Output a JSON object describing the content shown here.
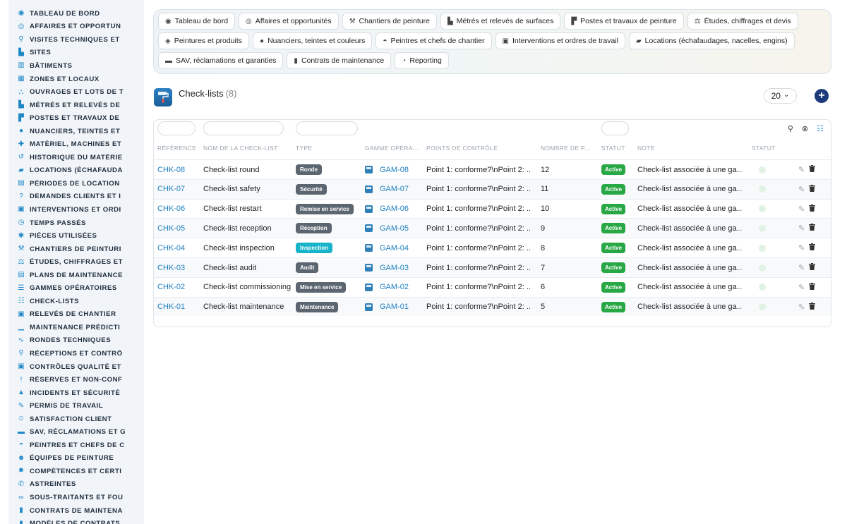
{
  "sidebar": {
    "items": [
      {
        "icon": "dashboard-icon",
        "glyph": "◉",
        "label": "TABLEAU DE BORD"
      },
      {
        "icon": "target-icon",
        "glyph": "◎",
        "label": "AFFAIRES ET OPPORTUN"
      },
      {
        "icon": "pin-icon",
        "glyph": "⚲",
        "label": "VISITES TECHNIQUES ET"
      },
      {
        "icon": "ruler-icon",
        "glyph": "▙",
        "label": "SITES"
      },
      {
        "icon": "building-icon",
        "glyph": "▥",
        "label": "BÂTIMENTS"
      },
      {
        "icon": "zones-icon",
        "glyph": "▦",
        "label": "ZONES ET LOCAUX"
      },
      {
        "icon": "hierarchy-icon",
        "glyph": "⛬",
        "label": "OUVRAGES ET LOTS DE T"
      },
      {
        "icon": "ruler-icon",
        "glyph": "▙",
        "label": "MÉTRÉS ET RELEVÉS DE"
      },
      {
        "icon": "paint-roller-icon",
        "glyph": "▛",
        "label": "POSTES ET TRAVAUX DE"
      },
      {
        "icon": "palette-icon",
        "glyph": "●",
        "label": "NUANCIERS, TEINTES ET"
      },
      {
        "icon": "tools-icon",
        "glyph": "✚",
        "label": "MATÉRIEL, MACHINES ET"
      },
      {
        "icon": "history-icon",
        "glyph": "↺",
        "label": "HISTORIQUE DU MATÉRIE"
      },
      {
        "icon": "truck-icon",
        "glyph": "▰",
        "label": "LOCATIONS (ÉCHAFAUDA"
      },
      {
        "icon": "calendar-icon",
        "glyph": "▤",
        "label": "PÉRIODES DE LOCATION"
      },
      {
        "icon": "question-icon",
        "glyph": "?",
        "label": "DEMANDES CLIENTS ET I"
      },
      {
        "icon": "clipboard-icon",
        "glyph": "▣",
        "label": "INTERVENTIONS ET ORDI"
      },
      {
        "icon": "clock-icon",
        "glyph": "◷",
        "label": "TEMPS PASSÉS"
      },
      {
        "icon": "puzzle-icon",
        "glyph": "✱",
        "label": "PIÈCES UTILISÉES"
      },
      {
        "icon": "hammer-icon",
        "glyph": "⚒",
        "label": "CHANTIERS DE PEINTURI"
      },
      {
        "icon": "drafting-icon",
        "glyph": "⚖",
        "label": "ÉTUDES, CHIFFRAGES ET"
      },
      {
        "icon": "calendar-icon",
        "glyph": "▤",
        "label": "PLANS DE MAINTENANCE"
      },
      {
        "icon": "list-icon",
        "glyph": "☰",
        "label": "GAMMES OPÉRATOIRES"
      },
      {
        "icon": "checklist-icon",
        "glyph": "☷",
        "label": "CHECK-LISTS"
      },
      {
        "icon": "clipboard-icon",
        "glyph": "▣",
        "label": "RELEVÉS DE CHANTIER"
      },
      {
        "icon": "chart-icon",
        "glyph": "▁",
        "label": "MAINTENANCE PRÉDICTI"
      },
      {
        "icon": "route-icon",
        "glyph": "∿",
        "label": "RONDES TECHNIQUES"
      },
      {
        "icon": "search-icon",
        "glyph": "⚲",
        "label": "RÉCEPTIONS ET CONTRÔ"
      },
      {
        "icon": "clipboard-check-icon",
        "glyph": "▣",
        "label": "CONTRÔLES QUALITÉ ET"
      },
      {
        "icon": "alert-circle-icon",
        "glyph": "!",
        "label": "RÉSERVES ET NON-CONF"
      },
      {
        "icon": "warning-icon",
        "glyph": "▲",
        "label": "INCIDENTS ET SÉCURITÉ"
      },
      {
        "icon": "signature-icon",
        "glyph": "✎",
        "label": "PERMIS DE TRAVAIL"
      },
      {
        "icon": "smile-icon",
        "glyph": "☺",
        "label": "SATISFACTION CLIENT"
      },
      {
        "icon": "comment-icon",
        "glyph": "▬",
        "label": "SAV, RÉCLAMATIONS ET G"
      },
      {
        "icon": "helmet-icon",
        "glyph": "◓",
        "label": "PEINTRES ET CHEFS DE C"
      },
      {
        "icon": "users-icon",
        "glyph": "☻",
        "label": "ÉQUIPES DE PEINTURE"
      },
      {
        "icon": "certificate-icon",
        "glyph": "✸",
        "label": "COMPÉTENCES ET CERTI"
      },
      {
        "icon": "phone-icon",
        "glyph": "✆",
        "label": "ASTREINTES"
      },
      {
        "icon": "handshake-icon",
        "glyph": "∞",
        "label": "SOUS-TRAITANTS ET FOU"
      },
      {
        "icon": "file-icon",
        "glyph": "▮",
        "label": "CONTRATS DE MAINTENA"
      },
      {
        "icon": "file-template-icon",
        "glyph": "▮",
        "label": "MODÈLES DE CONTRATS"
      }
    ]
  },
  "topnav": {
    "rows": [
      [
        {
          "icon": "dashboard-icon",
          "glyph": "◉",
          "label": "Tableau de bord"
        },
        {
          "icon": "target-icon",
          "glyph": "◎",
          "label": "Affaires et opportunités"
        },
        {
          "icon": "hammer-icon",
          "glyph": "⚒",
          "label": "Chantiers de peinture"
        },
        {
          "icon": "ruler-icon",
          "glyph": "▙",
          "label": "Métrés et relevés de surfaces"
        },
        {
          "icon": "paint-roller-icon",
          "glyph": "▛",
          "label": "Postes et travaux de peinture"
        },
        {
          "icon": "drafting-icon",
          "glyph": "⚖",
          "label": "Études, chiffrages et devis"
        }
      ],
      [
        {
          "icon": "fill-drip-icon",
          "glyph": "◈",
          "label": "Peintures et produits"
        },
        {
          "icon": "palette-icon",
          "glyph": "●",
          "label": "Nuanciers, teintes et couleurs"
        },
        {
          "icon": "helmet-icon",
          "glyph": "◓",
          "label": "Peintres et chefs de chantier"
        },
        {
          "icon": "clipboard-icon",
          "glyph": "▣",
          "label": "Interventions et ordres de travail"
        },
        {
          "icon": "truck-icon",
          "glyph": "▰",
          "label": "Locations (échafaudages, nacelles, engins)"
        }
      ],
      [
        {
          "icon": "comment-icon",
          "glyph": "▬",
          "label": "SAV, réclamations et garanties"
        },
        {
          "icon": "file-icon",
          "glyph": "▮",
          "label": "Contrats de maintenance"
        },
        {
          "icon": "pie-chart-icon",
          "glyph": "◔",
          "label": "Reporting"
        }
      ]
    ]
  },
  "page": {
    "title": "Check-lists",
    "count": "(8)",
    "page_size": "20",
    "page_size_caret": "⌄",
    "add_glyph": "+"
  },
  "table": {
    "headers": [
      "RÉFÉRENCE",
      "NOM DE LA CHECK-LIST",
      "TYPE",
      "GAMME OPÉRATOIRE",
      "POINTS DE CONTRÔLE",
      "NOMBRE DE POINTS",
      "STATUT",
      "NOTE",
      "STATUT"
    ],
    "header_display": [
      "RÉFÉRENCE",
      "NOM DE LA CHECK-LIST",
      "TYPE",
      "GAMME OPÉRA...",
      "POINTS DE CONTRÔLE",
      "NOMBRE DE P...",
      "STATUT",
      "NOTE",
      "STATUT"
    ],
    "rows": [
      {
        "ref": "CHK-08",
        "name": "Check-list round",
        "type": "Ronde",
        "type_color": "#5c6670",
        "gamme": "GAM-08",
        "points": "Point 1: conforme?\\nPoint 2: ...",
        "count": "12",
        "status": "Active",
        "note": "Check-list associée à une ga..."
      },
      {
        "ref": "CHK-07",
        "name": "Check-list safety",
        "type": "Sécurité",
        "type_color": "#5c6670",
        "gamme": "GAM-07",
        "points": "Point 1: conforme?\\nPoint 2: ...",
        "count": "11",
        "status": "Active",
        "note": "Check-list associée à une ga..."
      },
      {
        "ref": "CHK-06",
        "name": "Check-list restart",
        "type": "Remise en service",
        "type_color": "#5c6670",
        "gamme": "GAM-06",
        "points": "Point 1: conforme?\\nPoint 2: ...",
        "count": "10",
        "status": "Active",
        "note": "Check-list associée à une ga..."
      },
      {
        "ref": "CHK-05",
        "name": "Check-list reception",
        "type": "Réception",
        "type_color": "#5c6670",
        "gamme": "GAM-05",
        "points": "Point 1: conforme?\\nPoint 2: ...",
        "count": "9",
        "status": "Active",
        "note": "Check-list associée à une ga..."
      },
      {
        "ref": "CHK-04",
        "name": "Check-list inspection",
        "type": "Inspection",
        "type_color": "#17b3c9",
        "gamme": "GAM-04",
        "points": "Point 1: conforme?\\nPoint 2: ...",
        "count": "8",
        "status": "Active",
        "note": "Check-list associée à une ga..."
      },
      {
        "ref": "CHK-03",
        "name": "Check-list audit",
        "type": "Audit",
        "type_color": "#5c6670",
        "gamme": "GAM-03",
        "points": "Point 1: conforme?\\nPoint 2: ...",
        "count": "7",
        "status": "Active",
        "note": "Check-list associée à une ga..."
      },
      {
        "ref": "CHK-02",
        "name": "Check-list commissioning",
        "type": "Mise en service",
        "type_color": "#5c6670",
        "gamme": "GAM-02",
        "points": "Point 1: conforme?\\nPoint 2: ...",
        "count": "6",
        "status": "Active",
        "note": "Check-list associée à une ga..."
      },
      {
        "ref": "CHK-01",
        "name": "Check-list maintenance",
        "type": "Maintenance",
        "type_color": "#5c6670",
        "gamme": "GAM-01",
        "points": "Point 1: conforme?\\nPoint 2: ...",
        "count": "5",
        "status": "Active",
        "note": "Check-list associée à une ga..."
      }
    ]
  },
  "colors": {
    "accent": "#1e88c7",
    "link": "#1e7fc1",
    "active_badge": "#28a745",
    "add_button": "#1d3a7a"
  },
  "toolbar": {
    "search_glyph": "⚲",
    "clear_filter_glyph": "⊗",
    "columns_glyph": "☷"
  }
}
